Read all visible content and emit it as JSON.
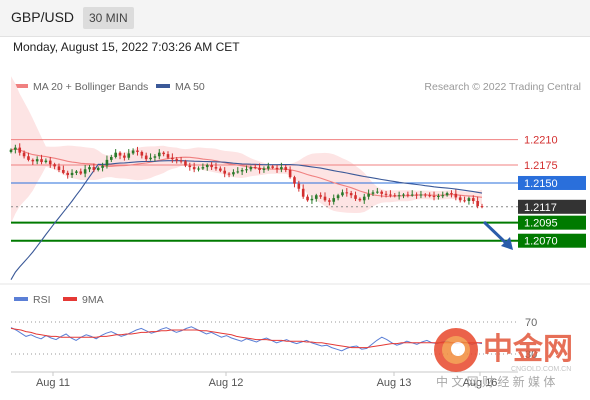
{
  "header": {
    "pair": "GBP/USD",
    "timeframe": "30 MIN"
  },
  "datetime": "Monday, August 15, 2022 7:03:26 AM CET",
  "legend": {
    "ma20": "MA 20 + Bollinger Bands",
    "ma50": "MA 50",
    "rsi": "RSI",
    "rsi9": "9MA"
  },
  "credit": "Research © 2022 Trading Central",
  "watermark": {
    "cn": "中金网",
    "sub": "中 文 网 财 经 新 媒 体",
    "url": "CNGOLD.COM.CN"
  },
  "colors": {
    "ma20": "#f08080",
    "ma50": "#3b5998",
    "bands": "#fde4e4",
    "resistance": "#f08080",
    "pivot": "#2a6fdb",
    "support": "#007a00",
    "current": "#333333",
    "up": "#2b7a2b",
    "down": "#d32f2f",
    "rsi": "#5b7fd6",
    "rsi9": "#e53935"
  },
  "chart_data": [
    {
      "type": "candlestick",
      "title": "GBP/USD",
      "ylim": [
        1.201,
        1.2265
      ],
      "x_ticks": [
        "Aug 11",
        "Aug 12",
        "Aug 13",
        "Aug 16"
      ],
      "levels": [
        {
          "value": 1.221,
          "label": "1.2210",
          "kind": "resistance"
        },
        {
          "value": 1.2175,
          "label": "1.2175",
          "kind": "resistance"
        },
        {
          "value": 1.215,
          "label": "1.2150",
          "kind": "pivot"
        },
        {
          "value": 1.2117,
          "label": "1.2117",
          "kind": "current"
        },
        {
          "value": 1.2095,
          "label": "1.2095",
          "kind": "support"
        },
        {
          "value": 1.207,
          "label": "1.2070",
          "kind": "support"
        }
      ],
      "series": [
        {
          "name": "MA 20 + Bollinger Bands"
        },
        {
          "name": "MA 50"
        }
      ],
      "close": [
        1.2196,
        1.2199,
        1.2192,
        1.2187,
        1.2182,
        1.218,
        1.2183,
        1.2179,
        1.2181,
        1.2176,
        1.2173,
        1.2168,
        1.2164,
        1.2161,
        1.2164,
        1.2166,
        1.2163,
        1.2169,
        1.2172,
        1.2168,
        1.2171,
        1.2174,
        1.2182,
        1.2186,
        1.2192,
        1.2188,
        1.2185,
        1.2191,
        1.2195,
        1.2193,
        1.2188,
        1.2183,
        1.2185,
        1.2187,
        1.2192,
        1.219,
        1.2185,
        1.2183,
        1.2181,
        1.218,
        1.2174,
        1.2172,
        1.2169,
        1.217,
        1.2172,
        1.2175,
        1.2172,
        1.217,
        1.2167,
        1.2163,
        1.2162,
        1.2165,
        1.2166,
        1.2168,
        1.2169,
        1.2172,
        1.2171,
        1.2168,
        1.217,
        1.2173,
        1.2171,
        1.2169,
        1.2172,
        1.2168,
        1.2158,
        1.2149,
        1.2142,
        1.2131,
        1.2126,
        1.2128,
        1.2133,
        1.2131,
        1.2126,
        1.2124,
        1.2129,
        1.2133,
        1.2137,
        1.2136,
        1.2133,
        1.2128,
        1.2126,
        1.2131,
        1.2135,
        1.2137,
        1.2138,
        1.2135,
        1.2134,
        1.2133,
        1.2132,
        1.2133,
        1.2134,
        1.2133,
        1.2134,
        1.2133,
        1.2134,
        1.2133,
        1.2132,
        1.2131,
        1.2132,
        1.2133,
        1.2136,
        1.2135,
        1.213,
        1.2126,
        1.2125,
        1.2129,
        1.2125,
        1.2118,
        1.2117
      ],
      "rsi": {
        "ylim": [
          20,
          80
        ],
        "levels": [
          70,
          30
        ],
        "rsi": [
          63,
          60,
          56,
          52,
          54,
          51,
          49,
          53,
          50,
          48,
          52,
          55,
          50,
          47,
          51,
          54,
          52,
          49,
          53,
          56,
          58,
          55,
          52,
          54,
          57,
          60,
          62,
          59,
          56,
          58,
          61,
          63,
          60,
          57,
          59,
          62,
          64,
          61,
          58,
          55,
          57,
          54,
          51,
          53,
          50,
          48,
          46,
          49,
          47,
          45,
          48,
          50,
          47,
          44,
          46,
          48,
          45,
          43,
          45,
          47,
          44,
          42,
          40,
          41,
          38,
          36,
          34,
          37,
          39,
          40,
          36,
          37,
          42,
          47,
          51,
          48,
          44,
          41,
          43,
          46,
          44,
          42,
          45,
          47,
          44,
          43,
          45,
          46,
          44,
          43,
          45,
          44,
          42,
          44,
          43
        ],
        "ma9": [
          62,
          61,
          60,
          58,
          57,
          55,
          54,
          53,
          52,
          52,
          51,
          51,
          51,
          51,
          51,
          51,
          51,
          51,
          52,
          52,
          53,
          54,
          54,
          55,
          55,
          56,
          57,
          57,
          58,
          58,
          59,
          59,
          60,
          60,
          60,
          60,
          60,
          60,
          59,
          59,
          58,
          57,
          56,
          55,
          54,
          52,
          51,
          50,
          49,
          48,
          48,
          48,
          47,
          47,
          47,
          46,
          46,
          46,
          46,
          45,
          45,
          44,
          44,
          43,
          42,
          41,
          40,
          39,
          38,
          38,
          38,
          38,
          39,
          40,
          41,
          42,
          43,
          43,
          44,
          44,
          44,
          44,
          44,
          44,
          44,
          44,
          44,
          44,
          44,
          44,
          44,
          44,
          44,
          44,
          44
        ]
      }
    }
  ]
}
